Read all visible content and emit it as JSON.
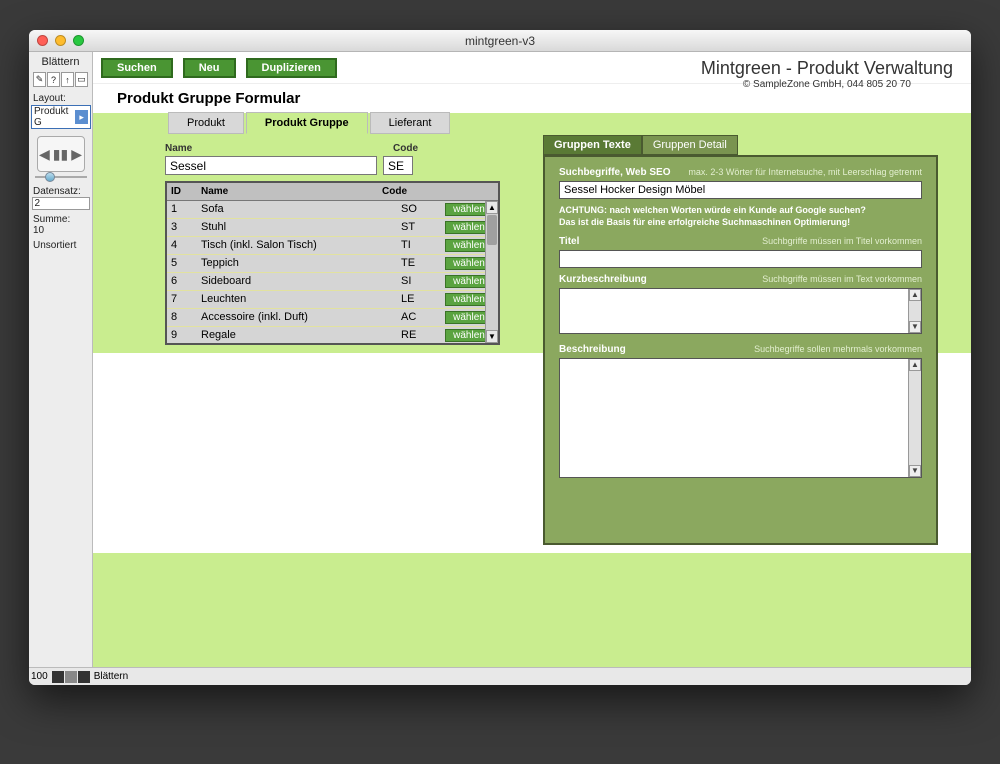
{
  "window": {
    "title": "mintgreen-v3"
  },
  "sidebar": {
    "section": "Blättern",
    "layout_label": "Layout:",
    "layout_value": "Produkt G",
    "datensatz_label": "Datensatz:",
    "datensatz_value": "2",
    "summe_label": "Summe:",
    "summe_value": "10",
    "sort_status": "Unsortiert"
  },
  "toolbar": {
    "search": "Suchen",
    "new": "Neu",
    "duplicate": "Duplizieren"
  },
  "brand": {
    "title": "Mintgreen - Produkt Verwaltung",
    "sub": "© SampleZone GmbH, 044 805 20 70"
  },
  "page": {
    "title": "Produkt Gruppe Formular",
    "tabs": [
      "Produkt",
      "Produkt Gruppe",
      "Lieferant"
    ],
    "active_tab": 1
  },
  "form": {
    "name_label": "Name",
    "code_label": "Code",
    "name_value": "Sessel",
    "code_value": "SE",
    "columns": {
      "id": "ID",
      "name": "Name",
      "code": "Code"
    },
    "rows": [
      {
        "id": "1",
        "name": "Sofa",
        "code": "SO"
      },
      {
        "id": "3",
        "name": "Stuhl",
        "code": "ST"
      },
      {
        "id": "4",
        "name": "Tisch (inkl. Salon Tisch)",
        "code": "TI"
      },
      {
        "id": "5",
        "name": "Teppich",
        "code": "TE"
      },
      {
        "id": "6",
        "name": "Sideboard",
        "code": "SI"
      },
      {
        "id": "7",
        "name": "Leuchten",
        "code": "LE"
      },
      {
        "id": "8",
        "name": "Accessoire (inkl. Duft)",
        "code": "AC"
      },
      {
        "id": "9",
        "name": "Regale",
        "code": "RE"
      }
    ],
    "select_btn": "wählen"
  },
  "detail": {
    "subtabs": [
      "Gruppen Texte",
      "Gruppen Detail"
    ],
    "active_subtab": 0,
    "seo_label": "Suchbegriffe, Web SEO",
    "seo_hint": "max. 2-3 Wörter für Internetsuche, mit Leerschlag getrennt",
    "seo_value": "Sessel Hocker Design Möbel",
    "notice": "ACHTUNG: nach welchen Worten würde ein Kunde auf Google suchen?\nDas ist die Basis für eine erfolgreiche Suchmaschinen Optimierung!",
    "titel_label": "Titel",
    "titel_hint": "Suchbgriffe müssen im Titel vorkommen",
    "kurz_label": "Kurzbeschreibung",
    "kurz_hint": "Suchbgriffe müssen im Text vorkommen",
    "beschr_label": "Beschreibung",
    "beschr_hint": "Suchbegriffe sollen mehrmals vorkommen"
  },
  "status": {
    "zoom": "100",
    "mode": "Blättern"
  }
}
